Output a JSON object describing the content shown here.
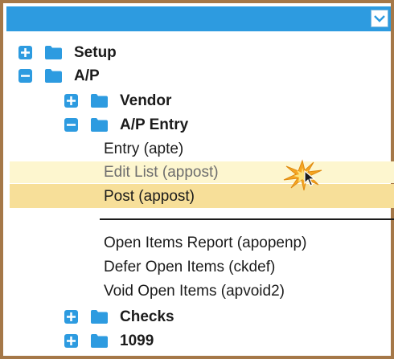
{
  "toolbar": {
    "dropdown_icon": "chevron-down-icon",
    "accent_color": "#2d9be0"
  },
  "tree": {
    "setup": {
      "label": "Setup",
      "expander": "plus",
      "icon": "folder-icon"
    },
    "ap": {
      "label": "A/P",
      "expander": "minus",
      "icon": "folder-icon"
    },
    "vendor": {
      "label": "Vendor",
      "expander": "plus",
      "icon": "folder-icon"
    },
    "ap_entry": {
      "label": "A/P Entry",
      "expander": "minus",
      "icon": "folder-icon"
    },
    "entry": {
      "label": "Entry (apte)"
    },
    "edit_list": {
      "label": "Edit List (appost)",
      "state": "hover"
    },
    "post": {
      "label": "Post (appost)",
      "state": "selected"
    },
    "open_items": {
      "label": "Open Items Report (apopenp)"
    },
    "defer_open_items": {
      "label": "Defer Open Items (ckdef)"
    },
    "void_open_items": {
      "label": "Void Open Items (apvoid2)"
    },
    "checks": {
      "label": "Checks",
      "expander": "plus",
      "icon": "folder-icon"
    },
    "form_1099": {
      "label": "1099",
      "expander": "plus",
      "icon": "folder-icon"
    }
  },
  "colors": {
    "frame_border": "#a57848",
    "hover_row": "#fdf6cf",
    "selected_row": "#f7df99",
    "click_burst": "#f5a623"
  }
}
